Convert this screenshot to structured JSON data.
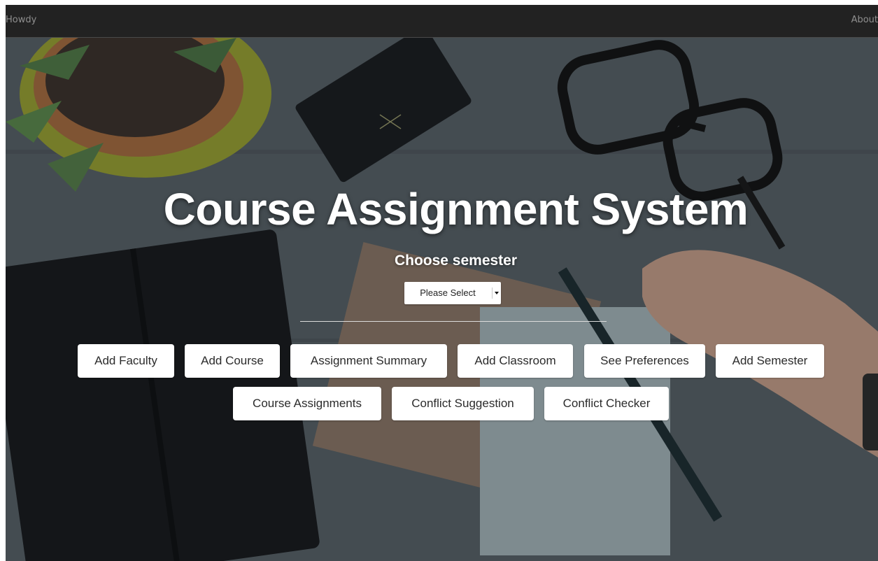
{
  "navbar": {
    "brand": "Howdy",
    "about": "About"
  },
  "hero": {
    "title": "Course Assignment System",
    "subtitle": "Choose semester",
    "semester_select": {
      "selected": "Please Select"
    },
    "buttons_row1": [
      {
        "label": "Add Faculty"
      },
      {
        "label": "Add Course"
      },
      {
        "label": "Assignment Summary"
      },
      {
        "label": "Add Classroom"
      },
      {
        "label": "See Preferences"
      },
      {
        "label": "Add Semester"
      }
    ],
    "buttons_row2": [
      {
        "label": "Course Assignments"
      },
      {
        "label": "Conflict Suggestion"
      },
      {
        "label": "Conflict Checker"
      }
    ]
  },
  "colors": {
    "navbar_bg": "#222222",
    "nav_text": "#8f8f8f",
    "title_text": "#ffffff",
    "button_bg": "#ffffff",
    "button_text": "#2b2b2b"
  }
}
